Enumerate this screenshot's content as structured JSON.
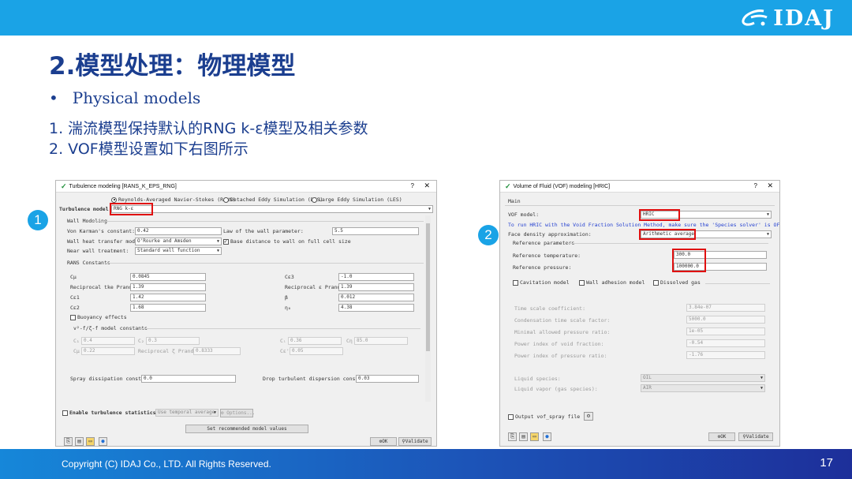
{
  "header": {
    "logo_text": "IDAJ"
  },
  "slide": {
    "title": "2.模型处理：物理模型",
    "bullet_symbol": "•",
    "bullet": "Physical models",
    "items": [
      "1. 湍流模型保持默认的RNG k-ε模型及相关参数",
      "2. VOF模型设置如下右图所示"
    ]
  },
  "badges": [
    "1",
    "2"
  ],
  "turb": {
    "title": "Turbulence modeling [RANS_K_EPS_RNG]",
    "help": "?",
    "close": "✕",
    "radio_rans": "Reynolds-Averaged Navier-Stokes (RANS)",
    "radio_des": "Detached Eddy Simulation (DES)",
    "radio_les": "Large Eddy Simulation (LES)",
    "model_label": "Turbulence model",
    "model_value": "RNG k-ε",
    "wall_modeling": "Wall Modeling",
    "von_karman_label": "Von Karman's constant:",
    "von_karman_value": "0.42",
    "law_label": "Law of the wall parameter:",
    "law_value": "5.5",
    "wall_heat_label": "Wall heat transfer model:",
    "wall_heat_value": "O'Rourke and Amsden",
    "base_dist_label": "Base distance to wall on full cell size",
    "near_wall_label": "Near wall treatment:",
    "near_wall_value": "Standard wall function",
    "rans_constants": "RANS Constants",
    "c_mu_label": "Cμ",
    "c_mu_value": "0.0845",
    "c_e3_label": "Cε3",
    "c_e3_value": "-1.0",
    "prandtl_label": "Reciprocal tke Prandtl",
    "prandtl_value": "1.39",
    "prandtl_eps_label": "Reciprocal ε Prandtl",
    "prandtl_eps_value": "1.39",
    "c_e1_label": "Cε1",
    "c_e1_value": "1.42",
    "beta_label": "β",
    "beta_value": "0.012",
    "c_e2_label": "Cε2",
    "c_e2_value": "1.68",
    "eta_label": "η₀",
    "eta_value": "4.38",
    "buoyancy": "Buoyancy effects",
    "v2f_header": "v²-f/ζ-f model constants",
    "c1_label": "C₁",
    "c1_value": "0.4",
    "c2_label": "C₂",
    "c2_value": "0.3",
    "cl_label": "Cₗ",
    "cl_value": "0.36",
    "ceta_label": "Cη",
    "ceta_value": "85.0",
    "cmuv_label": "Cμ",
    "cmuv_value": "0.22",
    "zeta_label": "Reciprocal ζ Prandtl",
    "zeta_value": "0.8333",
    "cep_label": "Cε'",
    "cep_value": "0.05",
    "spray_label": "Spray dissipation constant",
    "spray_value": "0.0",
    "drop_label": "Drop turbulent dispersion constant",
    "drop_value": "0.03",
    "enable_stats": "Enable turbulence statistics",
    "stats_combo": "Use temporal average",
    "options": "Options...",
    "set_recommended": "Set recommended model values",
    "ok": "OK",
    "validate": "Validate"
  },
  "vof": {
    "title": "Volume of Fluid (VOF) modeling [HRIC]",
    "help": "?",
    "close": "✕",
    "main": "Main",
    "vof_model_label": "VOF model:",
    "vof_model_value": "HRIC",
    "note": "To run HRIC with the Void Fraction Solution Method, make sure the 'Species solver' is OFF",
    "face_density_label": "Face density approximation:",
    "face_density_value": "Arithmetic average",
    "ref_params": "Reference parameters",
    "ref_temp_label": "Reference temperature:",
    "ref_temp_value": "300.0",
    "ref_press_label": "Reference pressure:",
    "ref_press_value": "100000.0",
    "cavitation": "Cavitation model",
    "wall_adhesion": "Wall adhesion model",
    "dissolved_gas": "Dissolved gas",
    "time_scale_label": "Time scale coefficient:",
    "time_scale_value": "3.84e-07",
    "cond_label": "Condensation time scale factor:",
    "cond_value": "5000.0",
    "min_press_label": "Minimal allowed pressure ratio:",
    "min_press_value": "1e-05",
    "void_pow_label": "Power index of void fraction:",
    "void_pow_value": "-0.54",
    "press_pow_label": "Power index of pressure ratio:",
    "press_pow_value": "-1.76",
    "liquid_label": "Liquid species:",
    "liquid_value": "OIL",
    "vapor_label": "Liquid vapor (gas species):",
    "vapor_value": "AIR",
    "output_vof": "Output vof_spray file",
    "ok": "OK",
    "validate": "Validate"
  },
  "footer": {
    "copyright": "Copyright (C)  IDAJ Co., LTD. All Rights Reserved.",
    "page": "17"
  }
}
